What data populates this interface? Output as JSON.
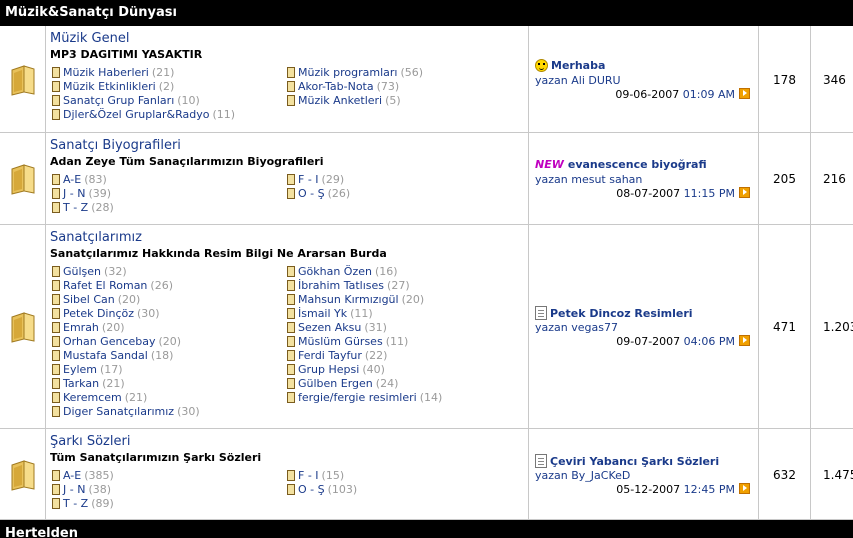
{
  "category": {
    "title": "Müzik&Sanatçı Dünyası"
  },
  "next_category": {
    "title": "Hertelden"
  },
  "forums": [
    {
      "title": "Müzik Genel",
      "description": "MP3 DAGITIMI YASAKTIR",
      "subforums": [
        {
          "name": "Müzik Haberleri",
          "count": "(21)"
        },
        {
          "name": "Müzik programları",
          "count": "(56)"
        },
        {
          "name": "Müzik Etkinlikleri",
          "count": "(2)"
        },
        {
          "name": "Akor-Tab-Nota",
          "count": "(73)"
        },
        {
          "name": "Sanatçı Grup Fanları",
          "count": "(10)"
        },
        {
          "name": "Müzik Anketleri",
          "count": "(5)"
        },
        {
          "name": "Djler&Özel Gruplar&Radyo",
          "count": "(11)"
        }
      ],
      "last_post": {
        "badge": "smiley",
        "title": "Merhaba",
        "author": "yazan Ali DURU",
        "date": "09-06-2007",
        "time": "01:09 AM"
      },
      "topics": "178",
      "posts": "346"
    },
    {
      "title": "Sanatçı Biyografileri",
      "description": "Adan Zeye Tüm Sanaçılarımızın Biyografileri",
      "subforums": [
        {
          "name": "A-E",
          "count": "(83)"
        },
        {
          "name": "F - I",
          "count": "(29)"
        },
        {
          "name": "J - N",
          "count": "(39)"
        },
        {
          "name": "O - Ş",
          "count": "(26)"
        },
        {
          "name": "T - Z",
          "count": "(28)"
        }
      ],
      "last_post": {
        "badge": "new",
        "badge_text": "NEW",
        "title": "evanescence biyoğrafi",
        "author": "yazan mesut sahan",
        "date": "08-07-2007",
        "time": "11:15 PM"
      },
      "topics": "205",
      "posts": "216"
    },
    {
      "title": "Sanatçılarımız",
      "description": "Sanatçılarımız Hakkında Resim Bilgi Ne Ararsan Burda",
      "subforums": [
        {
          "name": "Gülşen",
          "count": "(32)"
        },
        {
          "name": "Gökhan Özen",
          "count": "(16)"
        },
        {
          "name": "Rafet El Roman",
          "count": "(26)"
        },
        {
          "name": "İbrahim Tatlıses",
          "count": "(27)"
        },
        {
          "name": "Sibel Can",
          "count": "(20)"
        },
        {
          "name": "Mahsun Kırmızıgül",
          "count": "(20)"
        },
        {
          "name": "Petek Dinçöz",
          "count": "(30)"
        },
        {
          "name": "İsmail Yk",
          "count": "(11)"
        },
        {
          "name": "Emrah",
          "count": "(20)"
        },
        {
          "name": "Sezen Aksu",
          "count": "(31)"
        },
        {
          "name": "Orhan Gencebay",
          "count": "(20)"
        },
        {
          "name": "Müslüm Gürses",
          "count": "(11)"
        },
        {
          "name": "Mustafa Sandal",
          "count": "(18)"
        },
        {
          "name": "Ferdi Tayfur",
          "count": "(22)"
        },
        {
          "name": "Eylem",
          "count": "(17)"
        },
        {
          "name": "Grup Hepsi",
          "count": "(40)"
        },
        {
          "name": "Tarkan",
          "count": "(21)"
        },
        {
          "name": "Gülben Ergen",
          "count": "(24)"
        },
        {
          "name": "Keremcem",
          "count": "(21)"
        },
        {
          "name": "fergie/fergie resimleri",
          "count": "(14)"
        },
        {
          "name": "Diger Sanatçılarımız",
          "count": "(30)"
        }
      ],
      "last_post": {
        "badge": "doc",
        "title": "Petek Dincoz Resimleri",
        "author": "yazan vegas77",
        "date": "09-07-2007",
        "time": "04:06 PM"
      },
      "topics": "471",
      "posts": "1.203"
    },
    {
      "title": "Şarkı Sözleri",
      "description": "Tüm Sanatçılarımızın Şarkı Sözleri",
      "subforums": [
        {
          "name": "A-E",
          "count": "(385)"
        },
        {
          "name": "F - I",
          "count": "(15)"
        },
        {
          "name": "J - N",
          "count": "(38)"
        },
        {
          "name": "O - Ş",
          "count": "(103)"
        },
        {
          "name": "T - Z",
          "count": "(89)"
        }
      ],
      "last_post": {
        "badge": "doc",
        "title": "Çeviri Yabancı Şarkı Sözleri",
        "author": "yazan By_JaCKeD",
        "date": "05-12-2007",
        "time": "12:45 PM"
      },
      "topics": "632",
      "posts": "1.475"
    }
  ]
}
